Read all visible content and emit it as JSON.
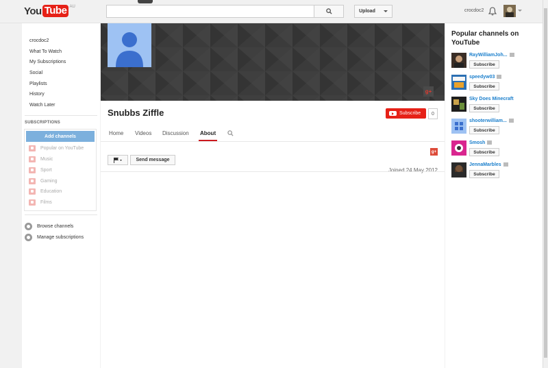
{
  "header": {
    "logo_you": "You",
    "logo_tube": "Tube",
    "logo_region": "AU",
    "search_value": "",
    "upload_label": "Upload",
    "username": "crocdoc2"
  },
  "guide": {
    "items": [
      "crocdoc2",
      "What To Watch",
      "My Subscriptions",
      "Social",
      "Playlists",
      "History",
      "Watch Later"
    ],
    "subscriptions_heading": "SUBSCRIPTIONS",
    "add_channels": "Add channels",
    "categories": [
      "Popular on YouTube",
      "Music",
      "Sport",
      "Gaming",
      "Education",
      "Films"
    ],
    "browse_channels": "Browse channels",
    "manage_subscriptions": "Manage subscriptions"
  },
  "channel": {
    "title": "Snubbs Ziffle",
    "subscribe_label": "Subscribe",
    "subscriber_count": "0",
    "tabs": [
      "Home",
      "Videos",
      "Discussion",
      "About"
    ],
    "active_tab": "About",
    "send_message": "Send message",
    "joined": "Joined 24 May 2012",
    "gplus": "g+"
  },
  "popular": {
    "title": "Popular channels on YouTube",
    "subscribe_label": "Subscribe",
    "channels": [
      {
        "name": "RayWilliamJoh...",
        "color": "#3a2e26"
      },
      {
        "name": "speedyw03",
        "color": "#2b6fb3"
      },
      {
        "name": "Sky Does Minecraft",
        "color": "#1e1e1e"
      },
      {
        "name": "shooterwilliam...",
        "color": "#5b9be0"
      },
      {
        "name": "Smosh",
        "color": "#d9268f"
      },
      {
        "name": "JennaMarbles",
        "color": "#2a2a2a"
      }
    ]
  },
  "colors": {
    "brand_red": "#e62117",
    "link_blue": "#1b7fcc",
    "add_channels_blue": "#7cb0dd"
  }
}
